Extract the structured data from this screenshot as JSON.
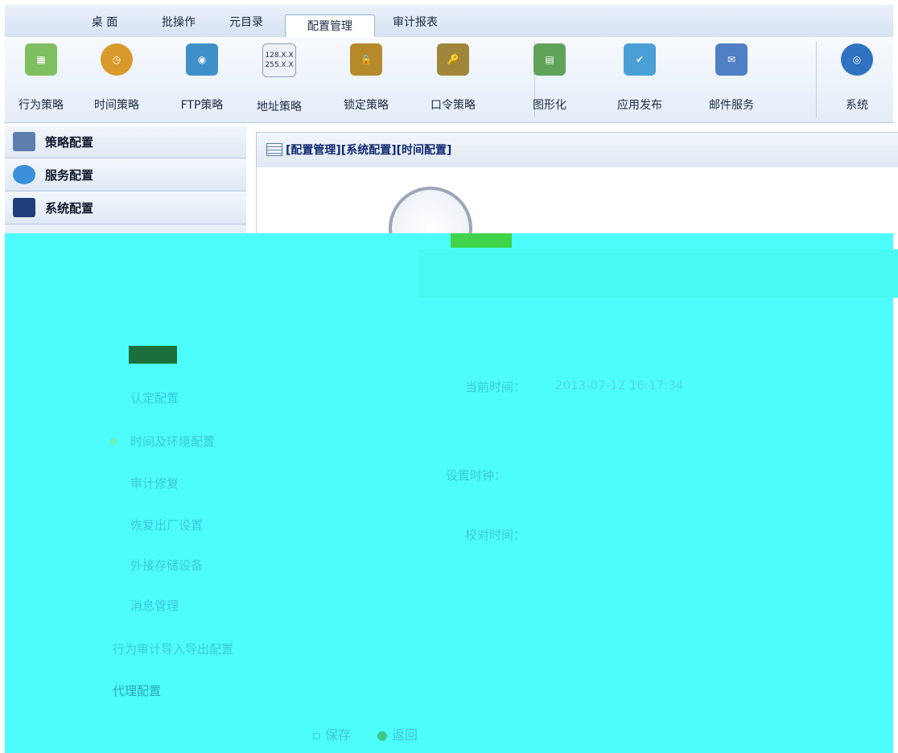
{
  "top_tabs": [
    "桌 面",
    "批操作",
    "元目录",
    "配置管理",
    "审计报表"
  ],
  "active_tab": "配置管理",
  "toolbar": [
    {
      "label": "行为策略",
      "icon": "behavior-policy-icon",
      "color": "#7fbf5f"
    },
    {
      "label": "时间策略",
      "icon": "time-policy-icon",
      "color": "#d99a2b"
    },
    {
      "label": "FTP策略",
      "icon": "ftp-policy-icon",
      "color": "#3f8fc9"
    },
    {
      "label": "地址策略",
      "icon": "address-policy-icon",
      "color": "#5c6f8a"
    },
    {
      "label": "锁定策略",
      "icon": "lock-policy-icon",
      "color": "#b48a2a"
    },
    {
      "label": "口令策略",
      "icon": "password-policy-icon",
      "color": "#a0863a"
    },
    {
      "label": "图形化",
      "icon": "graphic-icon",
      "color": "#5fa35a"
    },
    {
      "label": "应用发布",
      "icon": "app-publish-icon",
      "color": "#4a9fd6"
    },
    {
      "label": "邮件服务",
      "icon": "mail-service-icon",
      "color": "#4f7fc4"
    },
    {
      "label": "系统",
      "icon": "system-icon",
      "color": "#2e72c0"
    }
  ],
  "sidebar": [
    "策略配置",
    "服务配置",
    "系统配置"
  ],
  "breadcrumb": "[配置管理][系统配置][时间配置]",
  "ip_text": "128.X.X",
  "ip_text2": "255.X.X",
  "current_time_label": "当前时间：",
  "current_time_value": "2013-07-12 16:17:34",
  "set_clock_label": "设置时钟：",
  "sync_time_label": "校对时间：",
  "menu_items": [
    "认定配置",
    "时间及环境配置",
    "审计修复",
    "恢复出厂设置",
    "外接存储设备",
    "消息管理",
    "行为审计导入导出配置",
    "代理配置"
  ],
  "save_label": "保存",
  "back_label": "返回"
}
